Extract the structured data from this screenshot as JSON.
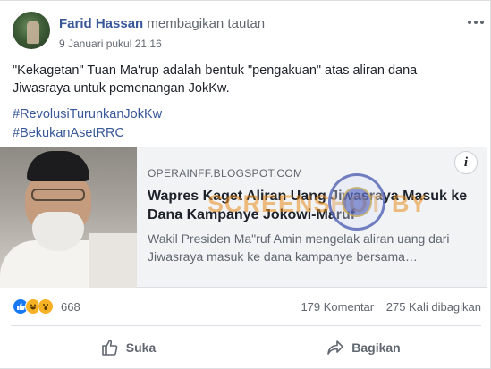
{
  "post": {
    "author": "Farid Hassan",
    "action": "membagikan tautan",
    "date": "9 Januari pukul 21.16",
    "text": "\"Kekagetan\" Tuan Ma'rup adalah bentuk \"pengakuan\" atas aliran dana Jiwasraya untuk pemenangan JokKw.",
    "hashtags": [
      "#RevolusiTurunkanJokKw",
      "#BekukanAsetRRC"
    ]
  },
  "link": {
    "domain": "OPERAINFF.BLOGSPOT.COM",
    "title": "Wapres Kaget Aliran Uang Jiwasraya Masuk ke Dana Kampanye Jokowi-Maruf",
    "description": "Wakil Presiden Ma\"ruf Amin mengelak aliran uang dari Jiwasraya masuk ke dana kampanye bersama…",
    "info_icon": "i"
  },
  "watermark": {
    "text": "SCREENSHOT BY"
  },
  "stats": {
    "reaction_icons": [
      "like-icon",
      "haha-icon",
      "wow-icon"
    ],
    "reaction_count": "668",
    "comments": "179 Komentar",
    "shares": "275 Kali dibagikan"
  },
  "actions": {
    "like_label": "Suka",
    "share_label": "Bagikan"
  },
  "colors": {
    "author": "#385898",
    "hashtag": "#385898",
    "like": "#1877f2",
    "watermark": "#e88a18"
  }
}
